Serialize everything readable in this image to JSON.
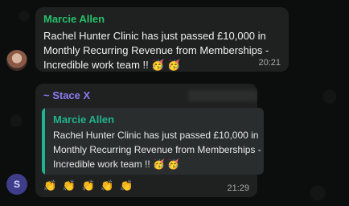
{
  "message1": {
    "sender": "Marcie Allen",
    "text": "Rachel Hunter Clinic has just passed £10,000 in Monthly Recurring Revenue from Memberships - Incredible work team !! 🥳 🥳",
    "time": "20:21"
  },
  "message2": {
    "sender": "~ Stace X",
    "avatar_letter": "S",
    "quote_sender": "Marcie Allen",
    "quote_text": "Rachel Hunter Clinic has just passed £10,000 in Monthly Recurring Revenue from Memberships - Incredible work team !! 🥳 🥳",
    "text": "👏 👏 👏 👏 👏",
    "time": "21:29"
  },
  "colors": {
    "sender1": "#26c06a",
    "sender2": "#8b7bf0",
    "quote_accent": "#20b38f",
    "bubble": "#1f2121"
  }
}
